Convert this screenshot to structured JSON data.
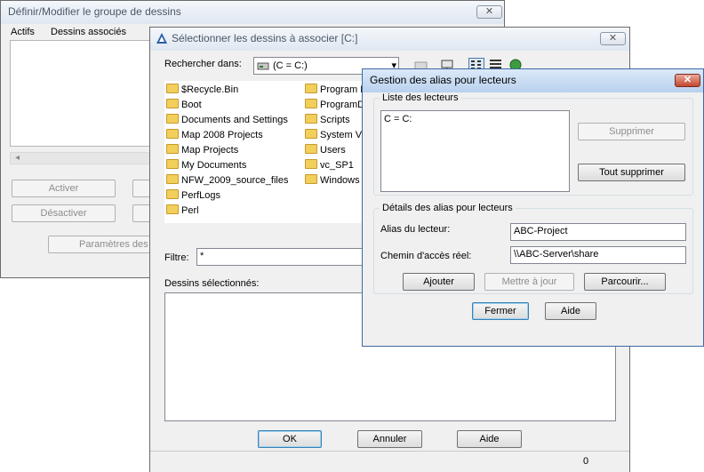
{
  "back_window": {
    "title": "Définir/Modifier le groupe de dessins",
    "close_glyph": "✕",
    "columns": [
      "Actifs",
      "Dessins associés"
    ],
    "buttons": {
      "activer": "Activer",
      "desactiver": "Désactiver",
      "parametres": "Paramètres des d"
    },
    "scroll_left_glyph": "◂"
  },
  "select_window": {
    "title": "Sélectionner les dessins à associer [C:]",
    "close_glyph": "✕",
    "rechercher_label": "Rechercher dans:",
    "rechercher_value": "(C = C:)",
    "dropdown_glyph": "▾",
    "files_left": [
      "$Recycle.Bin",
      "Boot",
      "Documents and Settings",
      "Map 2008 Projects",
      "Map Projects",
      "My Documents",
      "NFW_2009_source_files",
      "PerfLogs",
      "Perl"
    ],
    "files_right": [
      "Program F",
      "ProgramDa",
      "Scripts",
      "System Vo",
      "Users",
      "vc_SP1",
      "Windows"
    ],
    "filtre_label": "Filtre:",
    "filtre_value": "*",
    "selected_label": "Dessins sélectionnés:",
    "ok": "OK",
    "annuler": "Annuler",
    "aide": "Aide",
    "status_count": "0"
  },
  "alias_window": {
    "title": "Gestion des alias pour lecteurs",
    "close_glyph": "✕",
    "list_group": "Liste des lecteurs",
    "list_items": [
      "C = C:"
    ],
    "supprimer": "Supprimer",
    "tout_supprimer": "Tout supprimer",
    "details_group": "Détails des alias pour lecteurs",
    "alias_label": "Alias du lecteur:",
    "alias_value": "ABC-Project",
    "chemin_label": "Chemin d'accès réel:",
    "chemin_value": "\\\\ABC-Server\\share",
    "ajouter": "Ajouter",
    "mettre_a_jour": "Mettre à jour",
    "parcourir": "Parcourir...",
    "fermer": "Fermer",
    "aide": "Aide"
  }
}
